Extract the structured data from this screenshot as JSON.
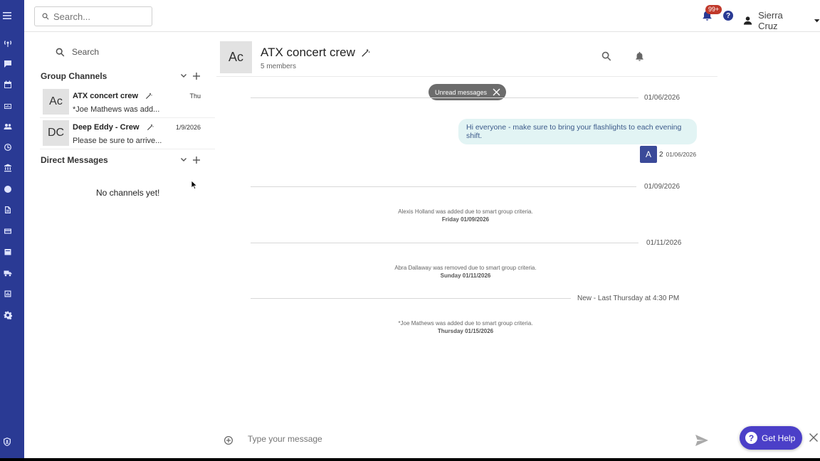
{
  "topbar": {
    "search_placeholder": "Search...",
    "notification_badge": "99+",
    "help_label": "?",
    "user_name": "Sierra Cruz"
  },
  "panel": {
    "search_label": "Search",
    "group_channels_title": "Group Channels",
    "direct_messages_title": "Direct Messages",
    "no_channels": "No channels yet!",
    "channels": [
      {
        "initials": "Ac",
        "name": "ATX concert crew",
        "date": "Thu",
        "preview": "*Joe Mathews was add..."
      },
      {
        "initials": "DC",
        "name": "Deep Eddy - Crew",
        "date": "1/9/2026",
        "preview": "Please be sure to arrive..."
      }
    ]
  },
  "chat": {
    "initials": "Ac",
    "title": "ATX concert crew",
    "members": "5 members",
    "unread_label": "Unread messages",
    "dividers": [
      "01/06/2026",
      "01/09/2026",
      "01/11/2026",
      "New - Last Thursday at 4:30 PM"
    ],
    "message": {
      "text": "Hi everyone - make sure to bring your flashlights to each evening shift.",
      "avatar": "A",
      "read_count": "2",
      "date": "01/06/2026"
    },
    "system_messages": [
      {
        "text": "Alexis Holland was added due to smart group criteria.",
        "date": "Friday 01/09/2026"
      },
      {
        "text": "Abra Dallaway was removed due to smart group criteria.",
        "date": "Sunday 01/11/2026"
      },
      {
        "text": "*Joe Mathews was added due to smart group criteria.",
        "date": "Thursday 01/15/2026"
      }
    ],
    "composer_placeholder": "Type your message"
  },
  "help_widget": {
    "label": "Get Help",
    "icon_label": "?"
  },
  "colors": {
    "rail": "#2a3a94",
    "bubble": "#e2f4f4",
    "help": "#4b3fc8",
    "badge": "#c0392b"
  }
}
